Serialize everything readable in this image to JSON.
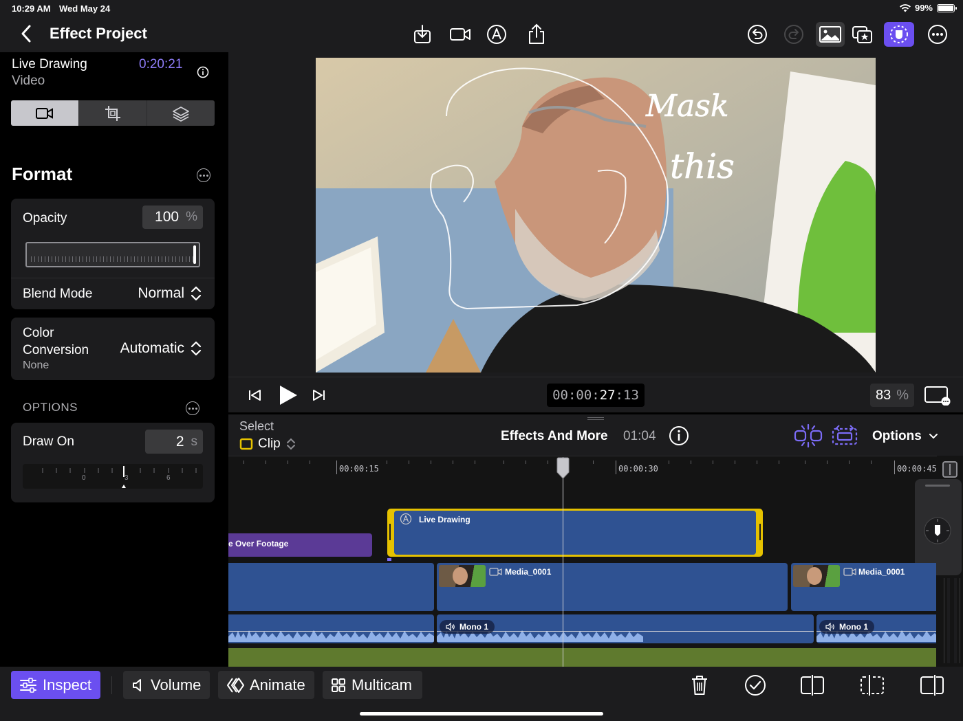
{
  "status": {
    "time": "10:29 AM",
    "date": "Wed May 24",
    "battery": "99%",
    "battery_level": 0.99
  },
  "topbar": {
    "title": "Effect Project",
    "icons": [
      "back-chevron-icon",
      "import-icon",
      "camera-icon",
      "live-drawing-icon",
      "share-icon",
      "undo-icon",
      "redo-icon",
      "photo-browser-icon",
      "effects-browser-icon",
      "inspector-mask-icon",
      "more-icon"
    ]
  },
  "inspector": {
    "clip_title": "Live Drawing",
    "clip_type": "Video",
    "duration": "0:20:21",
    "format_title": "Format",
    "opacity": {
      "label": "Opacity",
      "value": "100",
      "unit": "%",
      "level": 1.0
    },
    "blend_mode": {
      "label": "Blend Mode",
      "value": "Normal"
    },
    "color_conversion": {
      "label_line1": "Color",
      "label_line2": "Conversion",
      "sub": "None",
      "value": "Automatic"
    },
    "options_label": "OPTIONS",
    "draw_on": {
      "label": "Draw On",
      "value": "2",
      "unit": "s",
      "scale": [
        "0",
        "3",
        "6"
      ]
    }
  },
  "viewer": {
    "annotation_line1": "Mask",
    "annotation_line2": "this"
  },
  "transport": {
    "timecode_prefix": "00:00:",
    "timecode_main": "27",
    "timecode_frames": ":13",
    "zoom": "83",
    "zoom_unit": "%"
  },
  "timeline": {
    "select_label": "Select",
    "select_value": "Clip",
    "project_name": "Effects And More",
    "project_duration": "01:04",
    "options_label": "Options",
    "ruler": [
      "00:00:15",
      "00:00:30",
      "00:00:45"
    ],
    "clips": {
      "live_drawing": "Live Drawing",
      "over_footage": "e Over Footage",
      "media_a": "Media_0001",
      "media_b": "Media_0001",
      "audio_a": "Mono 1",
      "audio_b": "Mono 1"
    }
  },
  "bottombar": {
    "inspect": "Inspect",
    "volume": "Volume",
    "animate": "Animate",
    "multicam": "Multicam"
  },
  "colors": {
    "accent": "#6b4ff0",
    "clip_blue": "#2f5292",
    "clip_purple": "#5b3a96",
    "selection": "#e6c200",
    "track_green": "#5f7a2e"
  }
}
